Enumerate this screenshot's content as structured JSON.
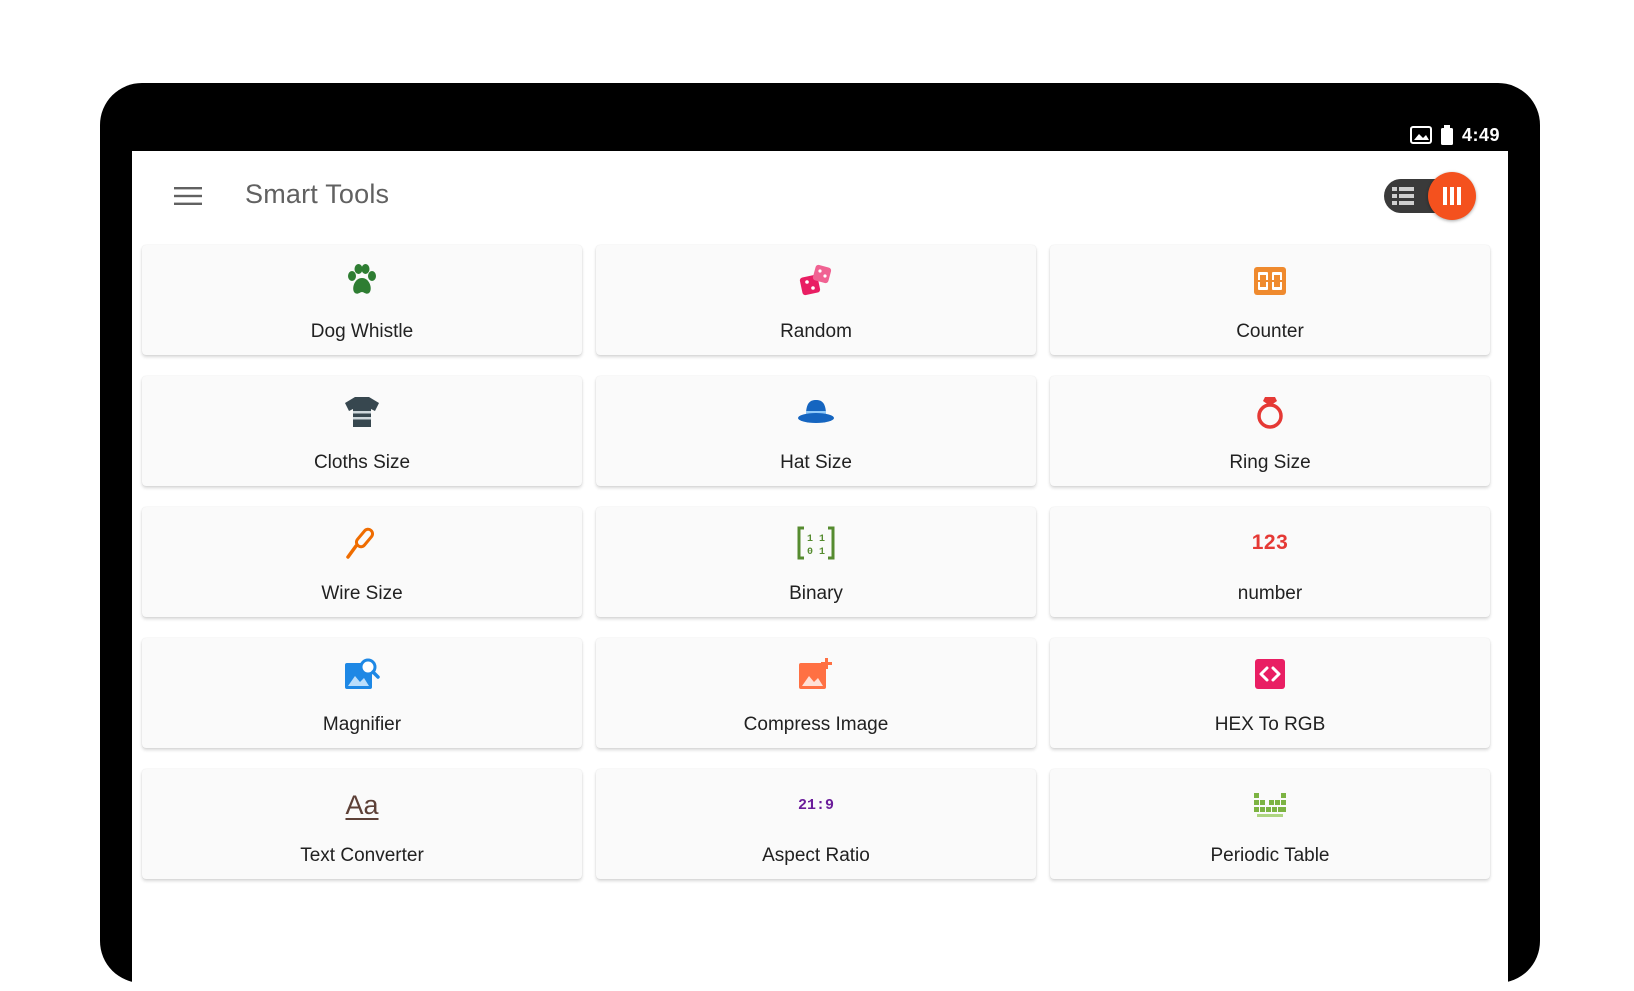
{
  "status_bar": {
    "time": "4:49"
  },
  "app_bar": {
    "title": "Smart Tools",
    "toggle_accent": "#f4511e"
  },
  "tools": [
    {
      "label": "Dog Whistle",
      "icon": "paw-icon",
      "color": "#2e7d32"
    },
    {
      "label": "Random",
      "icon": "dice-icon",
      "color": "#e91e63"
    },
    {
      "label": "Counter",
      "icon": "counter-icon",
      "color": "#ef8a2e"
    },
    {
      "label": "Cloths Size",
      "icon": "shirt-icon",
      "color": "#37474f"
    },
    {
      "label": "Hat Size",
      "icon": "hat-icon",
      "color": "#1565c0"
    },
    {
      "label": "Ring Size",
      "icon": "ring-icon",
      "color": "#e53935"
    },
    {
      "label": "Wire Size",
      "icon": "wire-icon",
      "color": "#ef6c00"
    },
    {
      "label": "Binary",
      "icon": "binary-icon",
      "color": "#558b2f",
      "glyph": "[101]"
    },
    {
      "label": "number",
      "icon": "number-icon",
      "color": "#e53935",
      "glyph": "123"
    },
    {
      "label": "Magnifier",
      "icon": "magnifier-icon",
      "color": "#1e88e5"
    },
    {
      "label": "Compress Image",
      "icon": "compress-image-icon",
      "color": "#ff7043"
    },
    {
      "label": "HEX To RGB",
      "icon": "hex-code-icon",
      "color": "#e91e63"
    },
    {
      "label": "Text Converter",
      "icon": "text-converter-icon",
      "color": "#5d4037",
      "glyph": "Aa"
    },
    {
      "label": "Aspect Ratio",
      "icon": "aspect-ratio-icon",
      "color": "#6a1b9a",
      "glyph": "21:9"
    },
    {
      "label": "Periodic Table",
      "icon": "periodic-table-icon",
      "color": "#7cb342"
    }
  ]
}
